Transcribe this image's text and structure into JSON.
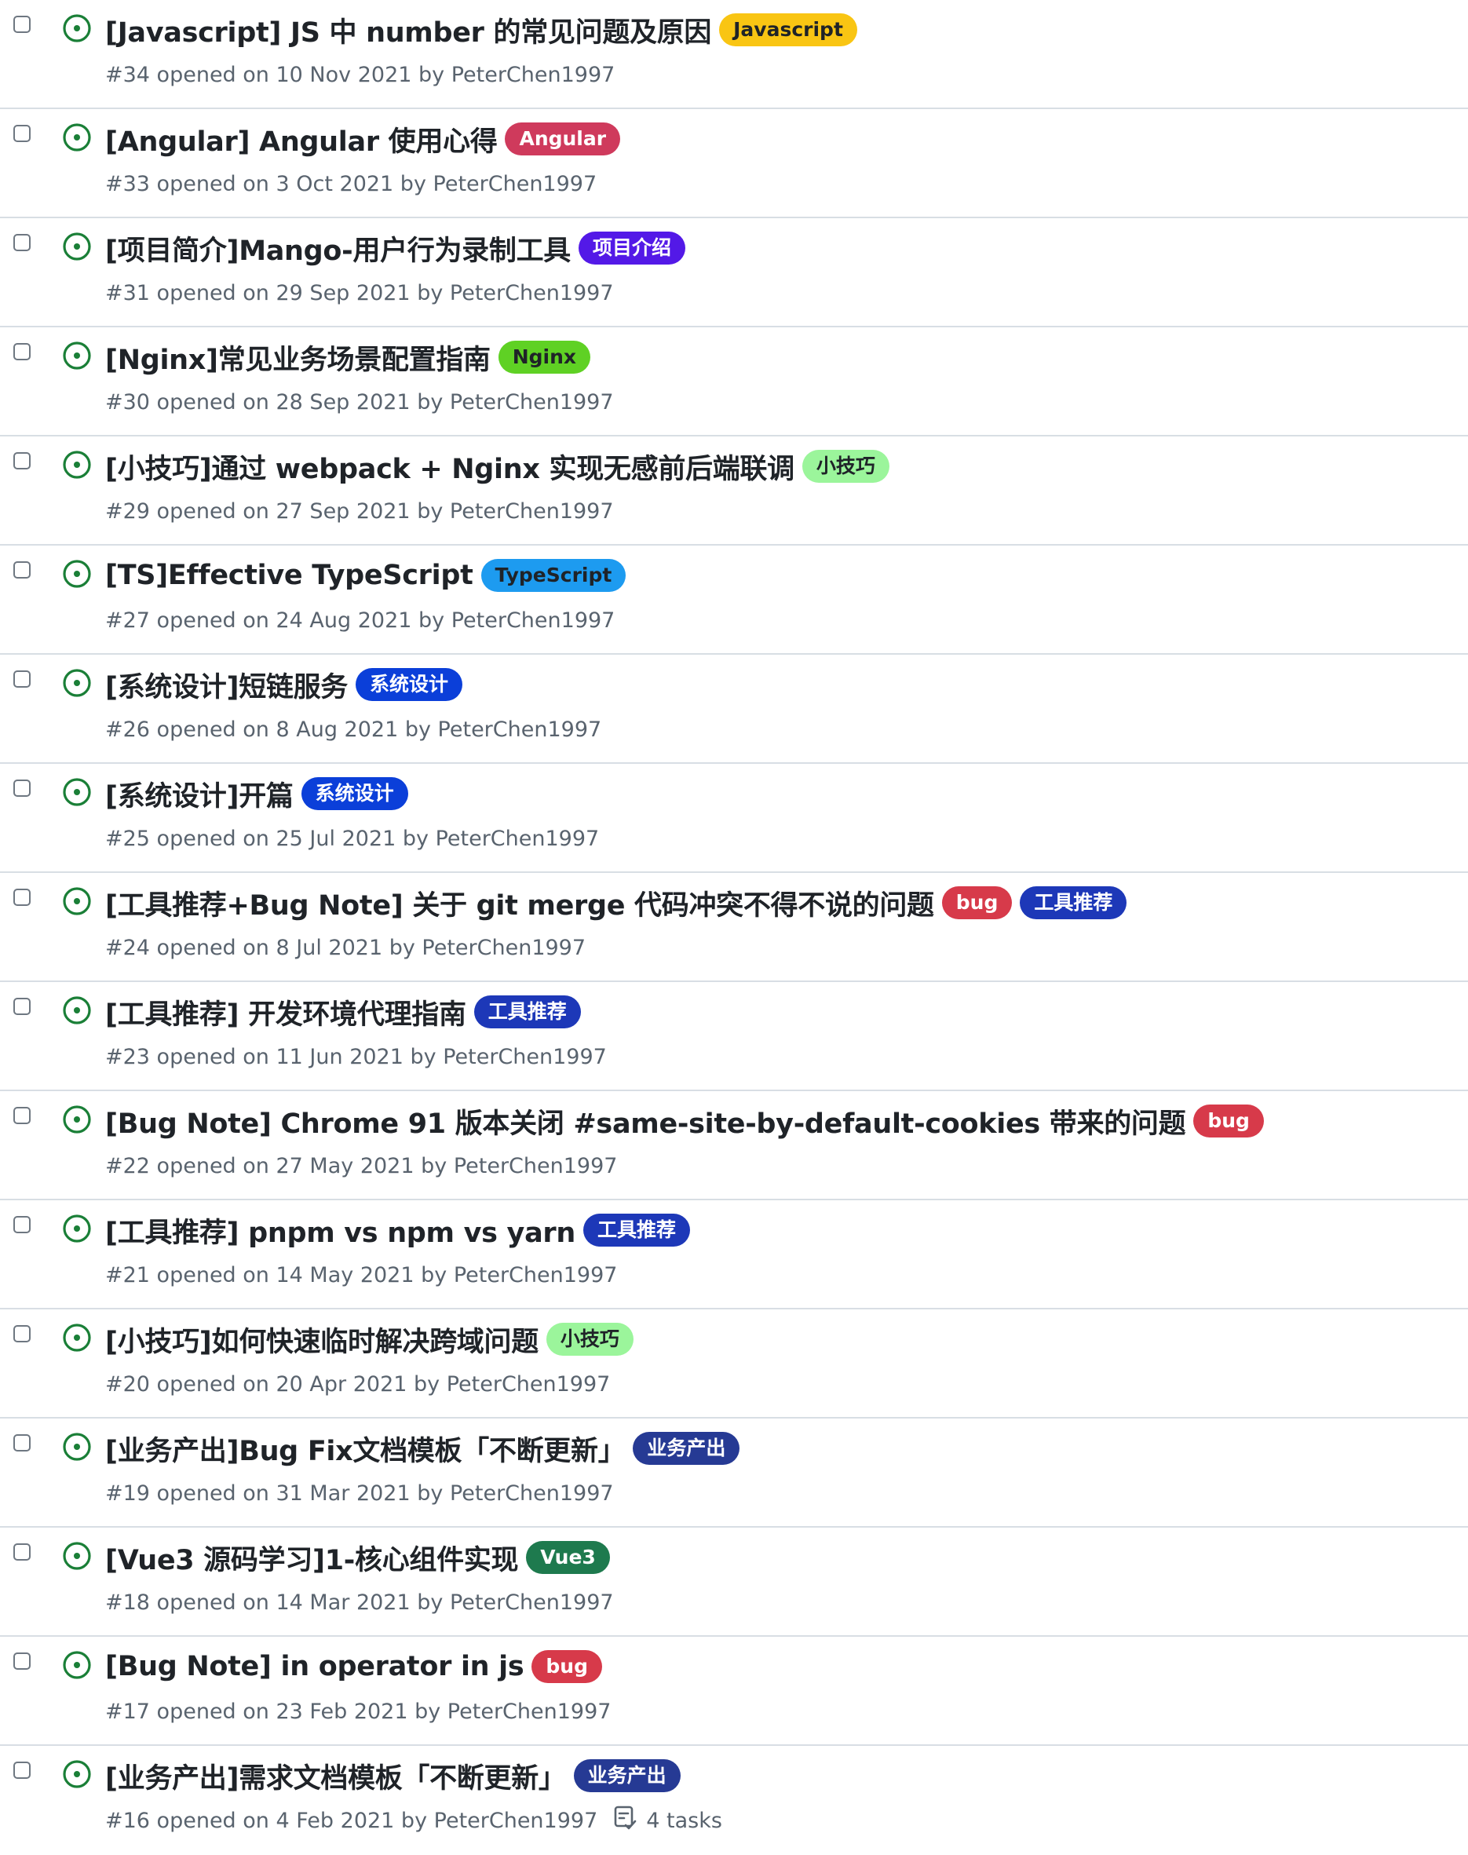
{
  "colors": {
    "open_icon": "#1a7f37",
    "border": "#d8dee4",
    "meta_text": "#59636e"
  },
  "issues": [
    {
      "title": "[Javascript] JS 中 number 的常见问题及原因",
      "meta": "#34 opened on 10 Nov 2021 by PeterChen1997",
      "labels": [
        {
          "text": "Javascript",
          "bg": "#f9c513",
          "fg": "#1f2328"
        }
      ]
    },
    {
      "title": "[Angular] Angular 使用心得",
      "meta": "#33 opened on 3 Oct 2021 by PeterChen1997",
      "labels": [
        {
          "text": "Angular",
          "bg": "#cf3a5c",
          "fg": "#ffffff"
        }
      ]
    },
    {
      "title": "[项目简介]Mango-用户行为录制工具",
      "meta": "#31 opened on 29 Sep 2021 by PeterChen1997",
      "labels": [
        {
          "text": "项目介绍",
          "bg": "#5319e7",
          "fg": "#ffffff"
        }
      ]
    },
    {
      "title": "[Nginx]常见业务场景配置指南",
      "meta": "#30 opened on 28 Sep 2021 by PeterChen1997",
      "labels": [
        {
          "text": "Nginx",
          "bg": "#5fd124",
          "fg": "#1f2328"
        }
      ]
    },
    {
      "title": "[小技巧]通过 webpack + Nginx 实现无感前后端联调",
      "meta": "#29 opened on 27 Sep 2021 by PeterChen1997",
      "labels": [
        {
          "text": "小技巧",
          "bg": "#9bf59b",
          "fg": "#1f2328"
        }
      ]
    },
    {
      "title": "[TS]Effective TypeScript",
      "meta": "#27 opened on 24 Aug 2021 by PeterChen1997",
      "labels": [
        {
          "text": "TypeScript",
          "bg": "#1d9bf0",
          "fg": "#1f2328"
        }
      ]
    },
    {
      "title": "[系统设计]短链服务",
      "meta": "#26 opened on 8 Aug 2021 by PeterChen1997",
      "labels": [
        {
          "text": "系统设计",
          "bg": "#0b3fd9",
          "fg": "#ffffff"
        }
      ]
    },
    {
      "title": "[系统设计]开篇",
      "meta": "#25 opened on 25 Jul 2021 by PeterChen1997",
      "labels": [
        {
          "text": "系统设计",
          "bg": "#0b3fd9",
          "fg": "#ffffff"
        }
      ]
    },
    {
      "title": "[工具推荐+Bug Note] 关于 git merge 代码冲突不得不说的问题",
      "meta": "#24 opened on 8 Jul 2021 by PeterChen1997",
      "labels": [
        {
          "text": "bug",
          "bg": "#d73a4a",
          "fg": "#ffffff"
        },
        {
          "text": "工具推荐",
          "bg": "#1d38b8",
          "fg": "#ffffff"
        }
      ]
    },
    {
      "title": "[工具推荐] 开发环境代理指南",
      "meta": "#23 opened on 11 Jun 2021 by PeterChen1997",
      "labels": [
        {
          "text": "工具推荐",
          "bg": "#1d38b8",
          "fg": "#ffffff"
        }
      ]
    },
    {
      "title": "[Bug Note] Chrome 91 版本关闭 #same-site-by-default-cookies 带来的问题",
      "meta": "#22 opened on 27 May 2021 by PeterChen1997",
      "labels": [
        {
          "text": "bug",
          "bg": "#d73a4a",
          "fg": "#ffffff"
        }
      ]
    },
    {
      "title": "[工具推荐] pnpm vs npm vs yarn",
      "meta": "#21 opened on 14 May 2021 by PeterChen1997",
      "labels": [
        {
          "text": "工具推荐",
          "bg": "#1d38b8",
          "fg": "#ffffff"
        }
      ]
    },
    {
      "title": "[小技巧]如何快速临时解决跨域问题",
      "meta": "#20 opened on 20 Apr 2021 by PeterChen1997",
      "labels": [
        {
          "text": "小技巧",
          "bg": "#9bf59b",
          "fg": "#1f2328"
        }
      ]
    },
    {
      "title": "[业务产出]Bug Fix文档模板「不断更新」",
      "meta": "#19 opened on 31 Mar 2021 by PeterChen1997",
      "labels": [
        {
          "text": "业务产出",
          "bg": "#263a94",
          "fg": "#ffffff"
        }
      ]
    },
    {
      "title": "[Vue3 源码学习]1-核心组件实现",
      "meta": "#18 opened on 14 Mar 2021 by PeterChen1997",
      "labels": [
        {
          "text": "Vue3",
          "bg": "#1e7a4e",
          "fg": "#ffffff"
        }
      ]
    },
    {
      "title": "[Bug Note] in operator in js",
      "meta": "#17 opened on 23 Feb 2021 by PeterChen1997",
      "labels": [
        {
          "text": "bug",
          "bg": "#d73a4a",
          "fg": "#ffffff"
        }
      ]
    },
    {
      "title": "[业务产出]需求文档模板「不断更新」",
      "meta": "#16 opened on 4 Feb 2021 by PeterChen1997",
      "labels": [
        {
          "text": "业务产出",
          "bg": "#263a94",
          "fg": "#ffffff"
        }
      ],
      "tasks": "4 tasks"
    }
  ]
}
